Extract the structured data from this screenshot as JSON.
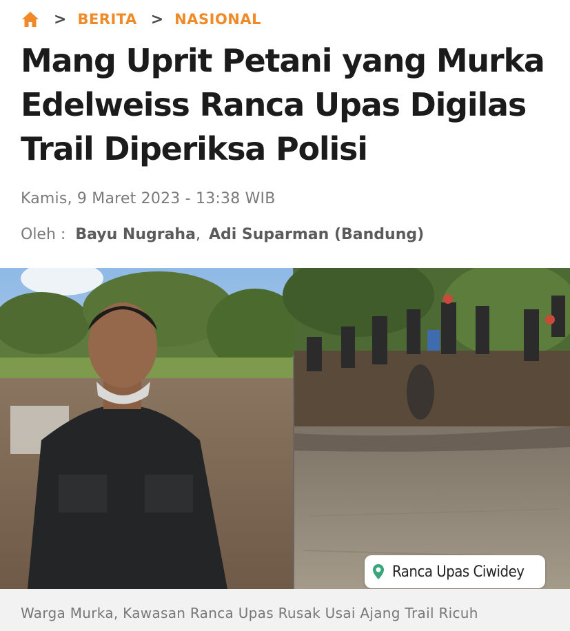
{
  "breadcrumb": {
    "items": [
      "BERITA",
      "NASIONAL"
    ],
    "separator": ">",
    "accent_color": "#f08a28",
    "home_icon": "home-icon"
  },
  "article": {
    "title": "Mang Uprit Petani yang Murka Edelweiss Ranca Upas Digilas Trail Diperiksa Polisi",
    "date": "Kamis, 9 Maret 2023 - 13:38 WIB",
    "byline_label": "Oleh :",
    "authors": [
      "Bayu Nugraha",
      "Adi Suparman (Bandung)"
    ]
  },
  "photo": {
    "location_label": "Ranca Upas Ciwidey",
    "location_icon": "map-pin-icon",
    "caption": "Warga Murka, Kawasan Ranca Upas Rusak Usai Ajang Trail Ricuh"
  }
}
